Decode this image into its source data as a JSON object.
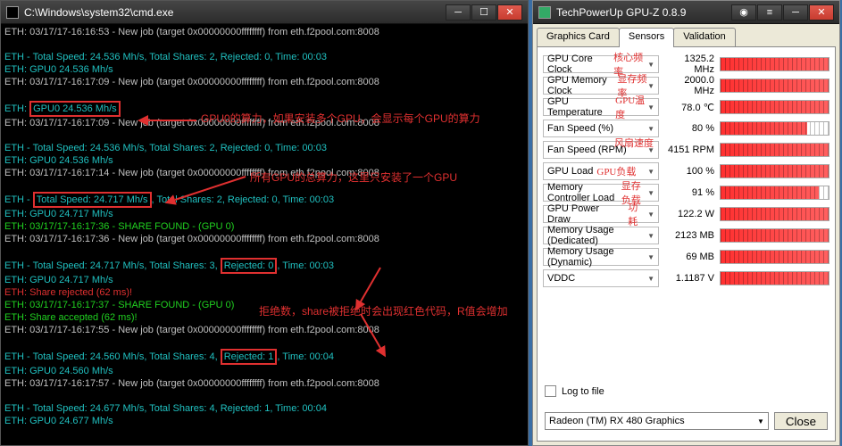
{
  "cmd": {
    "title": "C:\\Windows\\system32\\cmd.exe",
    "lines": [
      {
        "cls": "c-white",
        "txt": "ETH: 03/17/17-16:16:53 - New job (target 0x00000000ffffffff) from eth.f2pool.com:8008"
      },
      {
        "cls": "c-white",
        "txt": ""
      },
      {
        "cls": "c-cyan",
        "txt": "ETH - Total Speed: 24.536 Mh/s, Total Shares: 2, Rejected: 0, Time: 00:03"
      },
      {
        "cls": "c-cyan",
        "txt": "ETH: GPU0 24.536 Mh/s"
      },
      {
        "cls": "c-white",
        "txt": "ETH: 03/17/17-16:17:09 - New job (target 0x00000000ffffffff) from eth.f2pool.com:8008"
      },
      {
        "cls": "c-white",
        "txt": ""
      },
      {
        "cls": "c-cyan",
        "hl": true,
        "txt": "ETH: GPU0 24.536 Mh/s"
      },
      {
        "cls": "c-white",
        "txt": "ETH: 03/17/17-16:17:09 - New job (target 0x00000000ffffffff) from eth.f2pool.com:8008"
      },
      {
        "cls": "c-white",
        "txt": ""
      },
      {
        "cls": "c-cyan",
        "txt": "ETH - Total Speed: 24.536 Mh/s, Total Shares: 2, Rejected: 0, Time: 00:03"
      },
      {
        "cls": "c-cyan",
        "txt": "ETH: GPU0 24.536 Mh/s"
      },
      {
        "cls": "c-white",
        "txt": "ETH: 03/17/17-16:17:14 - New job (target 0x00000000ffffffff) from eth.f2pool.com:8008"
      },
      {
        "cls": "c-white",
        "txt": ""
      },
      {
        "cls": "c-cyan",
        "hlts": true,
        "txt": "ETH - Total Speed: 24.717 Mh/s, Total Shares: 2, Rejected: 0, Time: 00:03"
      },
      {
        "cls": "c-cyan",
        "txt": "ETH: GPU0 24.717 Mh/s"
      },
      {
        "cls": "c-green",
        "txt": "ETH: 03/17/17-16:17:36 - SHARE FOUND - (GPU 0)"
      },
      {
        "cls": "c-white",
        "txt": "ETH: 03/17/17-16:17:36 - New job (target 0x00000000ffffffff) from eth.f2pool.com:8008"
      },
      {
        "cls": "c-white",
        "txt": ""
      },
      {
        "cls": "c-cyan",
        "hlrj": true,
        "txt": "ETH - Total Speed: 24.717 Mh/s, Total Shares: 3, Rejected: 0, Time: 00:03"
      },
      {
        "cls": "c-cyan",
        "txt": "ETH: GPU0 24.717 Mh/s"
      },
      {
        "cls": "c-red",
        "txt": "ETH: Share rejected (62 ms)!"
      },
      {
        "cls": "c-green",
        "txt": "ETH: 03/17/17-16:17:37 - SHARE FOUND - (GPU 0)"
      },
      {
        "cls": "c-green",
        "txt": "ETH: Share accepted (62 ms)!"
      },
      {
        "cls": "c-white",
        "txt": "ETH: 03/17/17-16:17:55 - New job (target 0x00000000ffffffff) from eth.f2pool.com:8008"
      },
      {
        "cls": "c-white",
        "txt": ""
      },
      {
        "cls": "c-cyan",
        "hlrj": true,
        "txt": "ETH - Total Speed: 24.560 Mh/s, Total Shares: 4, Rejected: 1, Time: 00:04"
      },
      {
        "cls": "c-cyan",
        "txt": "ETH: GPU0 24.560 Mh/s"
      },
      {
        "cls": "c-white",
        "txt": "ETH: 03/17/17-16:17:57 - New job (target 0x00000000ffffffff) from eth.f2pool.com:8008"
      },
      {
        "cls": "c-white",
        "txt": ""
      },
      {
        "cls": "c-cyan",
        "txt": "ETH - Total Speed: 24.677 Mh/s, Total Shares: 4, Rejected: 1, Time: 00:04"
      },
      {
        "cls": "c-cyan",
        "txt": "ETH: GPU0 24.677 Mh/s"
      }
    ]
  },
  "annotations": {
    "gpu0": "GPU0的算力，如果安装多个GPU，会显示每个GPU的算力",
    "total": "所有GPU的总算力，这里只安装了一个GPU",
    "reject": "拒绝数，share被拒绝时会出现红色代码，R值会增加"
  },
  "gpuz": {
    "title": "TechPowerUp GPU-Z 0.8.9",
    "tabs": [
      "Graphics Card",
      "Sensors",
      "Validation"
    ],
    "activeTab": 1,
    "rows": [
      {
        "label": "GPU Core Clock",
        "zh": "核心频率",
        "val": "1325.2 MHz",
        "bar": ""
      },
      {
        "label": "GPU Memory Clock",
        "zh": "显存频率",
        "val": "2000.0 MHz",
        "bar": ""
      },
      {
        "label": "GPU Temperature",
        "zh": "GPU温度",
        "val": "78.0 ℃",
        "bar": ""
      },
      {
        "label": "Fan Speed (%)",
        "zh": "",
        "val": "80 %",
        "bar": "p80"
      },
      {
        "label": "Fan Speed (RPM)",
        "zh": "风扇速度",
        "zhAbove": true,
        "val": "4151 RPM",
        "bar": ""
      },
      {
        "label": "GPU Load",
        "zh": "GPU负载",
        "val": "100 %",
        "bar": ""
      },
      {
        "label": "Memory Controller Load",
        "zh": "显存负载",
        "val": "91 %",
        "bar": "p91"
      },
      {
        "label": "GPU Power Draw",
        "zh": "功耗",
        "val": "122.2 W",
        "bar": ""
      },
      {
        "label": "Memory Usage (Dedicated)",
        "zh": "",
        "val": "2123 MB",
        "bar": ""
      },
      {
        "label": "Memory Usage (Dynamic)",
        "zh": "",
        "val": "69 MB",
        "bar": ""
      },
      {
        "label": "VDDC",
        "zh": "",
        "val": "1.1187 V",
        "bar": ""
      }
    ],
    "logLabel": "Log to file",
    "gpuSelect": "Radeon (TM) RX 480 Graphics",
    "closeBtn": "Close"
  }
}
